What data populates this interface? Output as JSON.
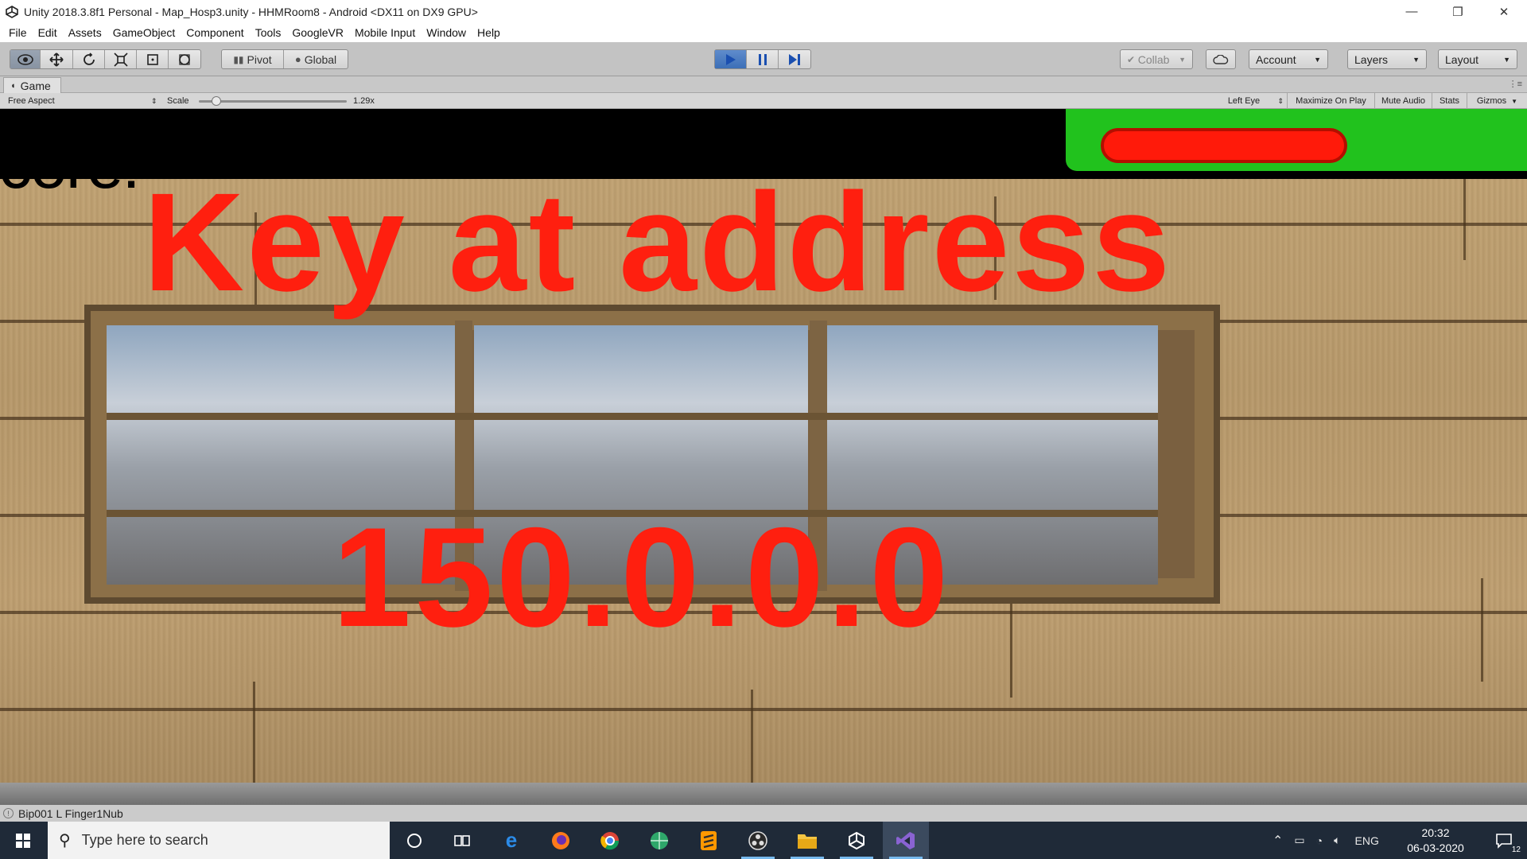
{
  "titlebar": {
    "title": "Unity 2018.3.8f1 Personal - Map_Hosp3.unity - HHMRoom8 - Android <DX11 on DX9 GPU>",
    "minimize": "—",
    "restore": "❐",
    "close": "✕"
  },
  "menu": [
    "File",
    "Edit",
    "Assets",
    "GameObject",
    "Component",
    "Tools",
    "GoogleVR",
    "Mobile Input",
    "Window",
    "Help"
  ],
  "toolbar": {
    "pivot_label": "Pivot",
    "global_label": "Global",
    "collab_label": "Collab",
    "account_label": "Account",
    "layers_label": "Layers",
    "layout_label": "Layout"
  },
  "game_tab": {
    "label": "Game",
    "aspect": "Free Aspect",
    "scale_label": "Scale",
    "scale_value": "1.29x",
    "scale_fraction": 0.12,
    "eye": "Left Eye",
    "maximize": "Maximize On Play",
    "mute": "Mute Audio",
    "stats": "Stats",
    "gizmos": "Gizmos"
  },
  "game_view": {
    "score_text": "core:",
    "key_text": "Key at address",
    "address_text": "150.0.0.0"
  },
  "statusbar": {
    "message": "Bip001 L Finger1Nub"
  },
  "taskbar": {
    "search_placeholder": "Type here to search",
    "language": "ENG",
    "time": "20:32",
    "date": "06-03-2020",
    "notification_count": "12"
  },
  "colors": {
    "overlay_text": "#ff1f0f",
    "health_bar_bg": "#21c21d",
    "health_bar_fill": "#ff1a0a",
    "taskbar_bg": "#1f2a38"
  }
}
